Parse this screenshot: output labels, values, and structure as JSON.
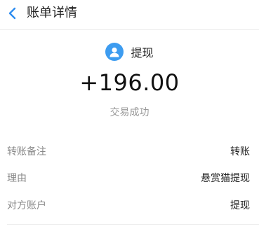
{
  "header": {
    "title": "账单详情"
  },
  "summary": {
    "type_label": "提现",
    "amount": "+196.00",
    "status": "交易成功",
    "avatar_color": "#3d9cf0"
  },
  "details": [
    {
      "label": "转账备注",
      "value": "转账"
    },
    {
      "label": "理由",
      "value": "悬赏猫提现"
    },
    {
      "label": "对方账户",
      "value": "提现"
    }
  ],
  "colors": {
    "accent": "#3d9cf0",
    "label_gray": "#888888",
    "status_gray": "#999999"
  }
}
